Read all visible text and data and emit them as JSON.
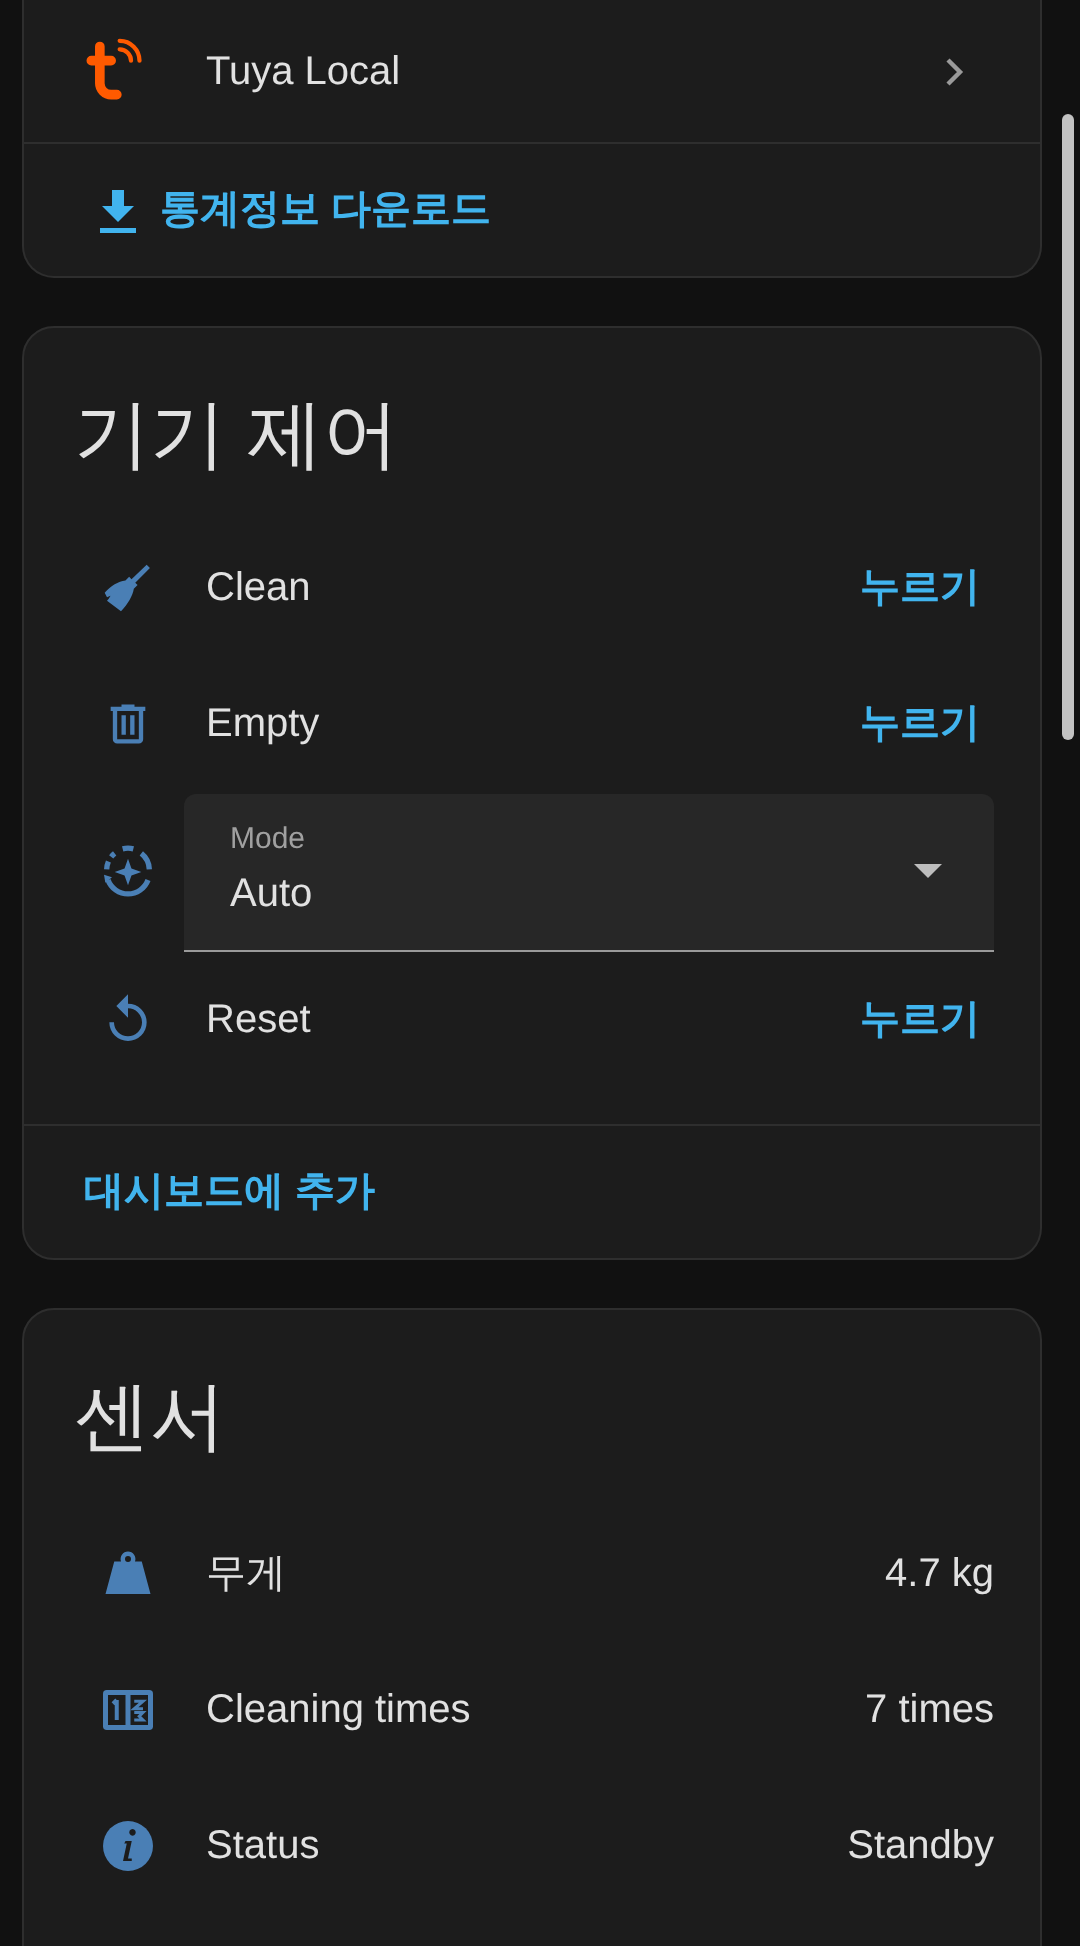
{
  "integration_card": {
    "integration": {
      "name": "Tuya Local"
    },
    "download_link": "통계정보 다운로드"
  },
  "controls_card": {
    "title": "기기 제어",
    "rows": [
      {
        "kind": "button",
        "name": "Clean",
        "action": "누르기"
      },
      {
        "kind": "button",
        "name": "Empty",
        "action": "누르기"
      },
      {
        "kind": "select",
        "label": "Mode",
        "value": "Auto"
      },
      {
        "kind": "button",
        "name": "Reset",
        "action": "누르기"
      }
    ],
    "add_link": "대시보드에 추가"
  },
  "sensors_card": {
    "title": "센서",
    "rows": [
      {
        "name": "무게",
        "value": "4.7 kg"
      },
      {
        "name": "Cleaning times",
        "value": "7 times"
      },
      {
        "name": "Status",
        "value": "Standby"
      }
    ]
  }
}
